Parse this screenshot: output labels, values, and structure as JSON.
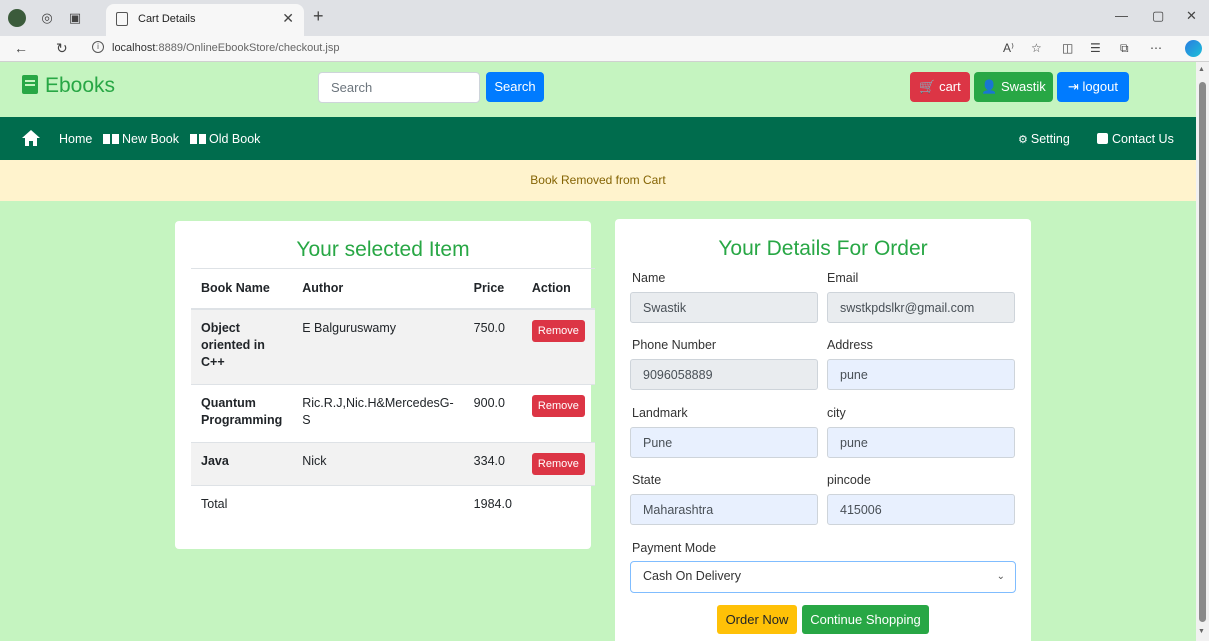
{
  "browser": {
    "tab_title": "Cart Details",
    "url_host": "localhost",
    "url_rest": ":8889/OnlineEbookStore/checkout.jsp"
  },
  "header": {
    "brand": "Ebooks",
    "search_placeholder": "Search",
    "search_button": "Search",
    "cart_button": "cart",
    "user_button": "Swastik",
    "logout_button": "logout"
  },
  "navbar": {
    "home": "Home",
    "new_book": "New Book",
    "old_book": "Old Book",
    "setting": "Setting",
    "contact": "Contact Us"
  },
  "alert": "Book Removed from Cart",
  "cart": {
    "title": "Your selected Item",
    "columns": [
      "Book Name",
      "Author",
      "Price",
      "Action"
    ],
    "rows": [
      {
        "book": "Object oriented in C++",
        "author": "E Balguruswamy",
        "price": "750.0",
        "action": "Remove"
      },
      {
        "book": "Quantum Programming",
        "author": "Ric.R.J,Nic.H&MercedesG-S",
        "price": "900.0",
        "action": "Remove"
      },
      {
        "book": "Java",
        "author": "Nick",
        "price": "334.0",
        "action": "Remove"
      }
    ],
    "total_label": "Total",
    "total_value": "1984.0"
  },
  "order": {
    "title": "Your Details For Order",
    "name_label": "Name",
    "name_value": "Swastik",
    "email_label": "Email",
    "email_value": "swstkpdslkr@gmail.com",
    "phone_label": "Phone Number",
    "phone_value": "9096058889",
    "address_label": "Address",
    "address_value": "pune",
    "landmark_label": "Landmark",
    "landmark_value": "Pune",
    "city_label": "city",
    "city_value": "pune",
    "state_label": "State",
    "state_value": "Maharashtra",
    "pincode_label": "pincode",
    "pincode_value": "415006",
    "payment_label": "Payment Mode",
    "payment_selected": "Cash On Delivery",
    "order_button": "Order Now",
    "continue_button": "Continue Shopping"
  }
}
